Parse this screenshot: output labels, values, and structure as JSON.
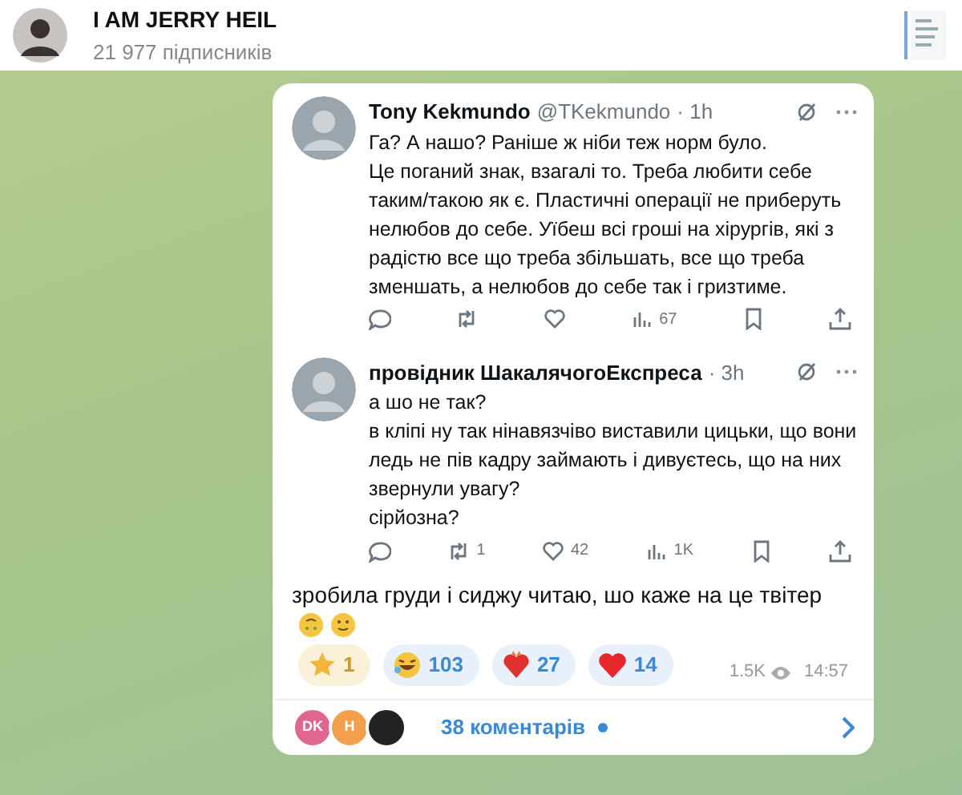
{
  "channel": {
    "title": "I AM JERRY HEIL",
    "subscribers": "21 977 підписників"
  },
  "tweets": [
    {
      "author": "Tony Kekmundo",
      "handle": "@TKekmundo",
      "time": "· 1h",
      "lines": [
        "Га? А нашо? Раніше ж ніби теж норм було.",
        "Це поганий знак, взагалі то. Треба любити себе таким/такою як є. Пластичні операції не приберуть нелюбов до себе. Уїбеш всі гроші на хірургів, які з радістю все що треба збільшать, все що треба зменшать, а нелюбов до себе так і гризтиме."
      ],
      "actions": [
        {
          "kind": "reply"
        },
        {
          "kind": "retweet"
        },
        {
          "kind": "like"
        },
        {
          "kind": "views",
          "count": "67"
        },
        {
          "kind": "bookmark"
        },
        {
          "kind": "share"
        }
      ]
    },
    {
      "author": "провідник ШакалячогоЕкспреса",
      "time": "· 3h",
      "lines": [
        "а шо не так?",
        "в кліпі ну так нінавязчіво виставили цицьки, що вони ледь не пів кадру займають і дивуєтесь, що на них звернули увагу?",
        "сірйозна?"
      ],
      "actions": [
        {
          "kind": "reply"
        },
        {
          "kind": "retweet",
          "count": "1"
        },
        {
          "kind": "like",
          "count": "42"
        },
        {
          "kind": "views",
          "count": "1K"
        },
        {
          "kind": "bookmark"
        },
        {
          "kind": "share"
        }
      ]
    }
  ],
  "message": "зробила груди і сиджу читаю, шо каже на це твітер",
  "reactions": [
    {
      "kind": "star",
      "count": "1"
    },
    {
      "kind": "laugh",
      "count": "103"
    },
    {
      "kind": "heart-fire",
      "count": "27"
    },
    {
      "kind": "heart",
      "count": "14"
    }
  ],
  "views": "1.5K",
  "time": "14:57",
  "comments": {
    "avatars": [
      {
        "initials": "DK",
        "color": "#e0668f"
      },
      {
        "initials": "H",
        "color": "#f2a04e"
      },
      {
        "color": "#222222"
      }
    ],
    "label": "38 коментарів",
    "unread": true
  }
}
